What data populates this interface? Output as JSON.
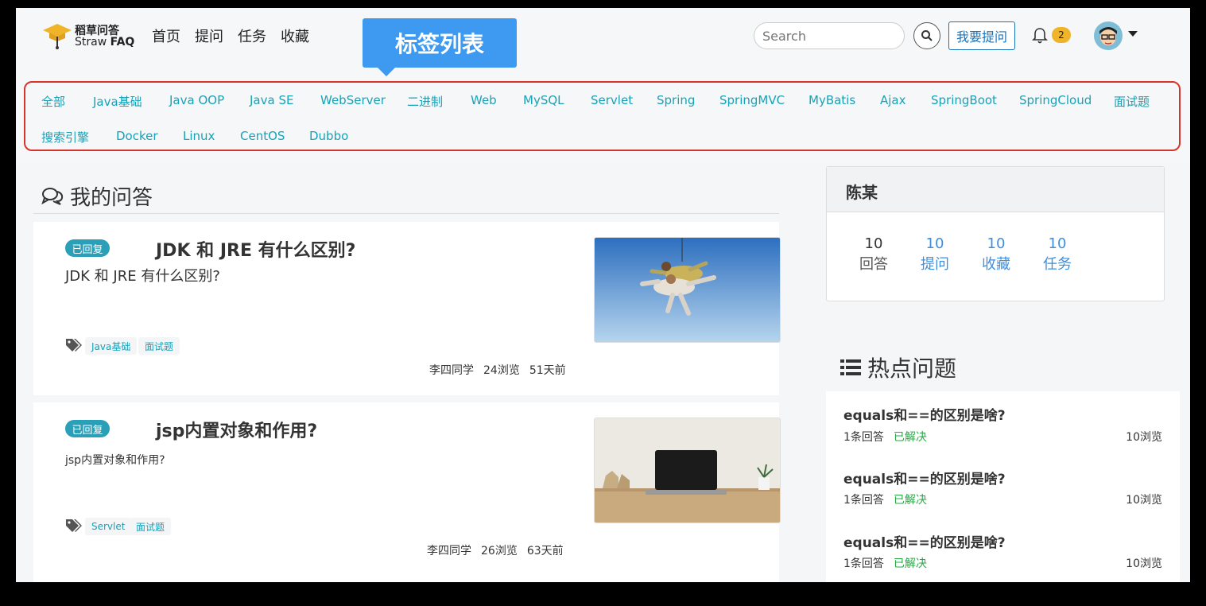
{
  "brand": {
    "cn": "稻草问答",
    "en_prefix": "Straw ",
    "en_bold": "FAQ"
  },
  "nav": [
    "首页",
    "提问",
    "任务",
    "收藏"
  ],
  "search": {
    "placeholder": "Search"
  },
  "ask_button": "我要提问",
  "notifications": {
    "count": "2"
  },
  "tooltip": "标签列表",
  "tags_row1": [
    "全部",
    "Java基础",
    "Java OOP",
    "Java SE",
    "WebServer",
    "二进制",
    "Web",
    "MySQL",
    "Servlet",
    "Spring",
    "SpringMVC",
    "MyBatis",
    "Ajax",
    "SpringBoot",
    "SpringCloud",
    "面试题"
  ],
  "tags_row2": [
    "搜索引擎",
    "Docker",
    "Linux",
    "CentOS",
    "Dubbo"
  ],
  "main": {
    "title": "我的问答",
    "questions": [
      {
        "status": "已回复",
        "title": "JDK 和 JRE 有什么区别?",
        "desc": "JDK 和 JRE 有什么区别?",
        "tags": [
          "Java基础",
          "面试题"
        ],
        "author": "李四同学",
        "views": "24浏览",
        "time": "51天前",
        "image": "skydivers"
      },
      {
        "status": "已回复",
        "title": "jsp内置对象和作用?",
        "desc": "jsp内置对象和作用?",
        "tags": [
          "Servlet",
          "面试题"
        ],
        "author": "李四同学",
        "views": "26浏览",
        "time": "63天前",
        "image": "laptop-on-desk"
      }
    ]
  },
  "user": {
    "name": "陈某",
    "stats": [
      {
        "value": "10",
        "label": "回答"
      },
      {
        "value": "10",
        "label": "提问"
      },
      {
        "value": "10",
        "label": "收藏"
      },
      {
        "value": "10",
        "label": "任务"
      }
    ]
  },
  "hot": {
    "title": "热点问题",
    "items": [
      {
        "title": "equals和==的区别是啥?",
        "answers": "1条回答",
        "status": "已解决",
        "views": "10浏览"
      },
      {
        "title": "equals和==的区别是啥?",
        "answers": "1条回答",
        "status": "已解决",
        "views": "10浏览"
      },
      {
        "title": "equals和==的区别是啥?",
        "answers": "1条回答",
        "status": "已解决",
        "views": "10浏览"
      }
    ]
  },
  "colors": {
    "accent": "#17a2b8",
    "tooltip": "#3d9af0",
    "highlight_border": "#d9342b",
    "solved": "#28a745",
    "badge": "#f0b429"
  }
}
